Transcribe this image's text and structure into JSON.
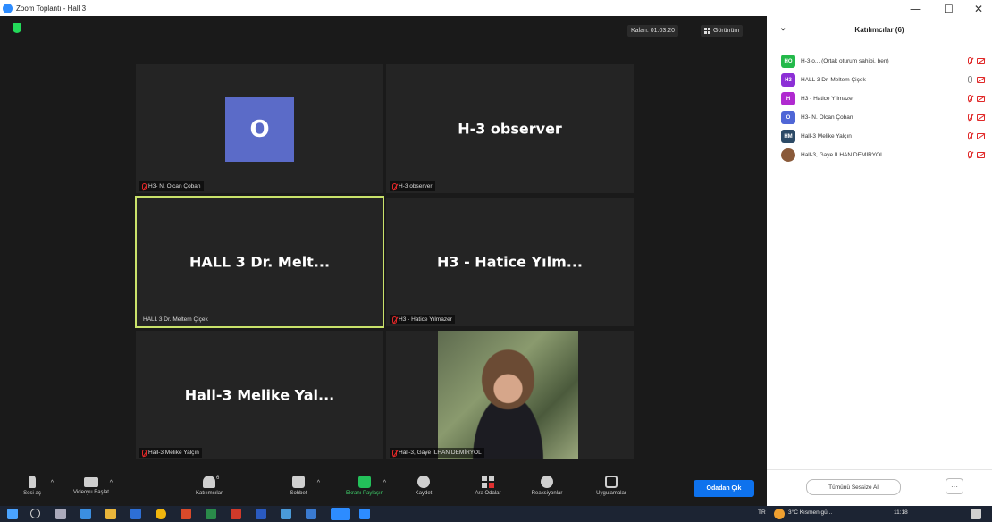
{
  "window": {
    "title": "Zoom Toplantı - Hall 3"
  },
  "window_controls": {
    "minimize": "—",
    "maximize": "☐",
    "close": "✕"
  },
  "topbar": {
    "remaining_label": "Kalan: 01:03:20",
    "view_label": "Görünüm"
  },
  "tiles": [
    {
      "big": "",
      "avatar_letter": "O",
      "tag": "H3- N. Olcan Çoban"
    },
    {
      "big": "H-3 observer",
      "tag": "H-3 observer"
    },
    {
      "big": "HALL 3 Dr. Melt...",
      "tag": "HALL 3 Dr. Meltem Çiçek"
    },
    {
      "big": "H3 - Hatice Yılm...",
      "tag": "H3 - Hatice Yılmazer"
    },
    {
      "big": "Hall-3 Melike Yal...",
      "tag": "Hall-3 Melike Yalçın"
    },
    {
      "big": "",
      "tag": "Hall-3, Gaye İLHAN DEMİRYOL"
    }
  ],
  "toolbar": {
    "mute": "Sesi aç",
    "video": "Videoyu Başlat",
    "participants": "Katılımcılar",
    "participants_count": "6",
    "chat": "Sohbet",
    "share": "Ekranı Paylaşın",
    "record": "Kaydet",
    "rooms": "Ara Odalar",
    "reactions": "Reaksiyonlar",
    "apps": "Uygulamalar",
    "end": "Odadan Çık"
  },
  "panel": {
    "title": "Katılımcılar (6)",
    "participants": [
      {
        "initials": "HO",
        "color": "#23b94a",
        "name": "H-3 o... (Ortak oturum sahibi, ben)",
        "mic": "off",
        "cam": "off"
      },
      {
        "initials": "H3",
        "color": "#8c2fd6",
        "name": "HALL 3 Dr. Meltem Çiçek",
        "mic": "on",
        "cam": "off"
      },
      {
        "initials": "H",
        "color": "#b02ad0",
        "name": "H3 - Hatice Yılmazer",
        "mic": "off",
        "cam": "off"
      },
      {
        "initials": "O",
        "color": "#4f66d6",
        "name": "H3- N. Olcan Çoban",
        "mic": "off",
        "cam": "off"
      },
      {
        "initials": "HM",
        "color": "#2c4a66",
        "name": "Hall-3 Melike Yalçın",
        "mic": "off",
        "cam": "off"
      },
      {
        "initials": "",
        "color": "#8a5a3a",
        "name": "Hall-3, Gaye İLHAN DEMİRYOL",
        "mic": "off",
        "cam": "off"
      }
    ],
    "mute_all": "Tümünü Sessize Al",
    "more": "···"
  },
  "taskbar": {
    "lang": "TR",
    "weather": "3°C Kısmen gü...",
    "time": "11:18"
  }
}
